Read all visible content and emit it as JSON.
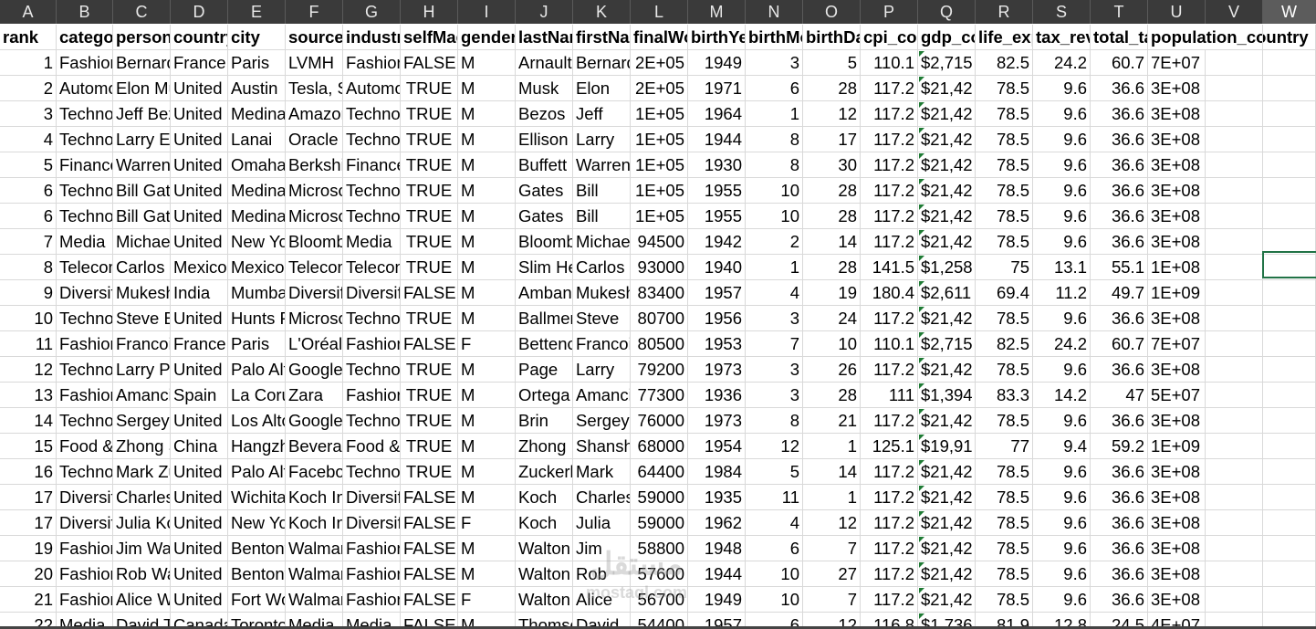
{
  "columns": [
    "A",
    "B",
    "C",
    "D",
    "E",
    "F",
    "G",
    "H",
    "I",
    "J",
    "K",
    "L",
    "M",
    "N",
    "O",
    "P",
    "Q",
    "R",
    "S",
    "T",
    "U",
    "V",
    "W"
  ],
  "selected_column": "W",
  "headers": [
    "rank",
    "category",
    "personName",
    "country",
    "city",
    "source",
    "industries",
    "selfMade",
    "gender",
    "lastName",
    "firstName",
    "finalWorth",
    "birthYear",
    "birthMonth",
    "birthDay",
    "cpi_country",
    "gdp_country",
    "life_expectancy_country",
    "tax_revenue_country_country",
    "total_tax_rate_country",
    "population_country"
  ],
  "rows": [
    [
      "1",
      "Fashion & Retail",
      "Bernard Arnault & family",
      "France",
      "Paris",
      "LVMH",
      "Fashion & Retail",
      "FALSE",
      "M",
      "Arnault",
      "Bernard",
      "2E+05",
      "1949",
      "3",
      "5",
      "110.1",
      "$2,715",
      "82.5",
      "24.2",
      "60.7",
      "7E+07"
    ],
    [
      "2",
      "Automotive",
      "Elon Musk",
      "United States",
      "Austin",
      "Tesla, SpaceX",
      "Automotive",
      "TRUE",
      "M",
      "Musk",
      "Elon",
      "2E+05",
      "1971",
      "6",
      "28",
      "117.2",
      "$21,42",
      "78.5",
      "9.6",
      "36.6",
      "3E+08"
    ],
    [
      "3",
      "Technology",
      "Jeff Bezos",
      "United States",
      "Medina",
      "Amazon",
      "Technology",
      "TRUE",
      "M",
      "Bezos",
      "Jeff",
      "1E+05",
      "1964",
      "1",
      "12",
      "117.2",
      "$21,42",
      "78.5",
      "9.6",
      "36.6",
      "3E+08"
    ],
    [
      "4",
      "Technology",
      "Larry Ellison",
      "United States",
      "Lanai",
      "Oracle",
      "Technology",
      "TRUE",
      "M",
      "Ellison",
      "Larry",
      "1E+05",
      "1944",
      "8",
      "17",
      "117.2",
      "$21,42",
      "78.5",
      "9.6",
      "36.6",
      "3E+08"
    ],
    [
      "5",
      "Finance",
      "Warren Buffett",
      "United States",
      "Omaha",
      "Berkshire Hathaway",
      "Finance",
      "TRUE",
      "M",
      "Buffett",
      "Warren",
      "1E+05",
      "1930",
      "8",
      "30",
      "117.2",
      "$21,42",
      "78.5",
      "9.6",
      "36.6",
      "3E+08"
    ],
    [
      "6",
      "Technology",
      "Bill Gates",
      "United States",
      "Medina",
      "Microsoft",
      "Technology",
      "TRUE",
      "M",
      "Gates",
      "Bill",
      "1E+05",
      "1955",
      "10",
      "28",
      "117.2",
      "$21,42",
      "78.5",
      "9.6",
      "36.6",
      "3E+08"
    ],
    [
      "6",
      "Technology",
      "Bill Gates",
      "United States",
      "Medina",
      "Microsoft",
      "Technology",
      "TRUE",
      "M",
      "Gates",
      "Bill",
      "1E+05",
      "1955",
      "10",
      "28",
      "117.2",
      "$21,42",
      "78.5",
      "9.6",
      "36.6",
      "3E+08"
    ],
    [
      "7",
      "Media",
      "Michael Bloomberg",
      "United States",
      "New York",
      "Bloomberg LP",
      "Media",
      "TRUE",
      "M",
      "Bloomberg",
      "Michael",
      "94500",
      "1942",
      "2",
      "14",
      "117.2",
      "$21,42",
      "78.5",
      "9.6",
      "36.6",
      "3E+08"
    ],
    [
      "8",
      "Telecom",
      "Carlos Slim Helu",
      "Mexico",
      "Mexico City",
      "Telecom",
      "Telecom",
      "TRUE",
      "M",
      "Slim Helu",
      "Carlos",
      "93000",
      "1940",
      "1",
      "28",
      "141.5",
      "$1,258",
      "75",
      "13.1",
      "55.1",
      "1E+08"
    ],
    [
      "9",
      "Diversified",
      "Mukesh Ambani",
      "India",
      "Mumbai",
      "Diversified",
      "Diversified",
      "FALSE",
      "M",
      "Ambani",
      "Mukesh",
      "83400",
      "1957",
      "4",
      "19",
      "180.4",
      "$2,611",
      "69.4",
      "11.2",
      "49.7",
      "1E+09"
    ],
    [
      "10",
      "Technology",
      "Steve Ballmer",
      "United States",
      "Hunts Point",
      "Microsoft",
      "Technology",
      "TRUE",
      "M",
      "Ballmer",
      "Steve",
      "80700",
      "1956",
      "3",
      "24",
      "117.2",
      "$21,42",
      "78.5",
      "9.6",
      "36.6",
      "3E+08"
    ],
    [
      "11",
      "Fashion & Retail",
      "Francoise Bettencourt Meyers",
      "France",
      "Paris",
      "L'Oréal",
      "Fashion & Retail",
      "FALSE",
      "F",
      "Bettencourt Meyers",
      "Francoise",
      "80500",
      "1953",
      "7",
      "10",
      "110.1",
      "$2,715",
      "82.5",
      "24.2",
      "60.7",
      "7E+07"
    ],
    [
      "12",
      "Technology",
      "Larry Page",
      "United States",
      "Palo Alto",
      "Google",
      "Technology",
      "TRUE",
      "M",
      "Page",
      "Larry",
      "79200",
      "1973",
      "3",
      "26",
      "117.2",
      "$21,42",
      "78.5",
      "9.6",
      "36.6",
      "3E+08"
    ],
    [
      "13",
      "Fashion & Retail",
      "Amancio Ortega",
      "Spain",
      "La Coruña",
      "Zara",
      "Fashion & Retail",
      "TRUE",
      "M",
      "Ortega",
      "Amancio",
      "77300",
      "1936",
      "3",
      "28",
      "111",
      "$1,394",
      "83.3",
      "14.2",
      "47",
      "5E+07"
    ],
    [
      "14",
      "Technology",
      "Sergey Brin",
      "United States",
      "Los Altos",
      "Google",
      "Technology",
      "TRUE",
      "M",
      "Brin",
      "Sergey",
      "76000",
      "1973",
      "8",
      "21",
      "117.2",
      "$21,42",
      "78.5",
      "9.6",
      "36.6",
      "3E+08"
    ],
    [
      "15",
      "Food & Beverage",
      "Zhong Shanshan",
      "China",
      "Hangzhou",
      "Beverages, pharmaceuticals",
      "Food & Beverage",
      "TRUE",
      "M",
      "Zhong",
      "Shanshan",
      "68000",
      "1954",
      "12",
      "1",
      "125.1",
      "$19,91",
      "77",
      "9.4",
      "59.2",
      "1E+09"
    ],
    [
      "16",
      "Technology",
      "Mark Zuckerberg",
      "United States",
      "Palo Alto",
      "Facebook",
      "Technology",
      "TRUE",
      "M",
      "Zuckerberg",
      "Mark",
      "64400",
      "1984",
      "5",
      "14",
      "117.2",
      "$21,42",
      "78.5",
      "9.6",
      "36.6",
      "3E+08"
    ],
    [
      "17",
      "Diversified",
      "Charles Koch",
      "United States",
      "Wichita",
      "Koch Industries",
      "Diversified",
      "FALSE",
      "M",
      "Koch",
      "Charles",
      "59000",
      "1935",
      "11",
      "1",
      "117.2",
      "$21,42",
      "78.5",
      "9.6",
      "36.6",
      "3E+08"
    ],
    [
      "17",
      "Diversified",
      "Julia Koch & family",
      "United States",
      "New York",
      "Koch Industries",
      "Diversified",
      "FALSE",
      "F",
      "Koch",
      "Julia",
      "59000",
      "1962",
      "4",
      "12",
      "117.2",
      "$21,42",
      "78.5",
      "9.6",
      "36.6",
      "3E+08"
    ],
    [
      "19",
      "Fashion & Retail",
      "Jim Walton",
      "United States",
      "Bentonville",
      "Walmart",
      "Fashion & Retail",
      "FALSE",
      "M",
      "Walton",
      "Jim",
      "58800",
      "1948",
      "6",
      "7",
      "117.2",
      "$21,42",
      "78.5",
      "9.6",
      "36.6",
      "3E+08"
    ],
    [
      "20",
      "Fashion & Retail",
      "Rob Walton",
      "United States",
      "Bentonville",
      "Walmart",
      "Fashion & Retail",
      "FALSE",
      "M",
      "Walton",
      "Rob",
      "57600",
      "1944",
      "10",
      "27",
      "117.2",
      "$21,42",
      "78.5",
      "9.6",
      "36.6",
      "3E+08"
    ],
    [
      "21",
      "Fashion & Retail",
      "Alice Walton",
      "United States",
      "Fort Worth",
      "Walmart",
      "Fashion & Retail",
      "FALSE",
      "F",
      "Walton",
      "Alice",
      "56700",
      "1949",
      "10",
      "7",
      "117.2",
      "$21,42",
      "78.5",
      "9.6",
      "36.6",
      "3E+08"
    ],
    [
      "22",
      "Media",
      "David Thomson",
      "Canada",
      "Toronto",
      "Media",
      "Media",
      "FALSE",
      "M",
      "Thomson",
      "David",
      "54400",
      "1957",
      "6",
      "12",
      "116.8",
      "$1,736",
      "81.9",
      "12.8",
      "24.5",
      "4E+07"
    ]
  ],
  "watermark": {
    "line1": "مستقل",
    "line2": "mostaql.com"
  }
}
